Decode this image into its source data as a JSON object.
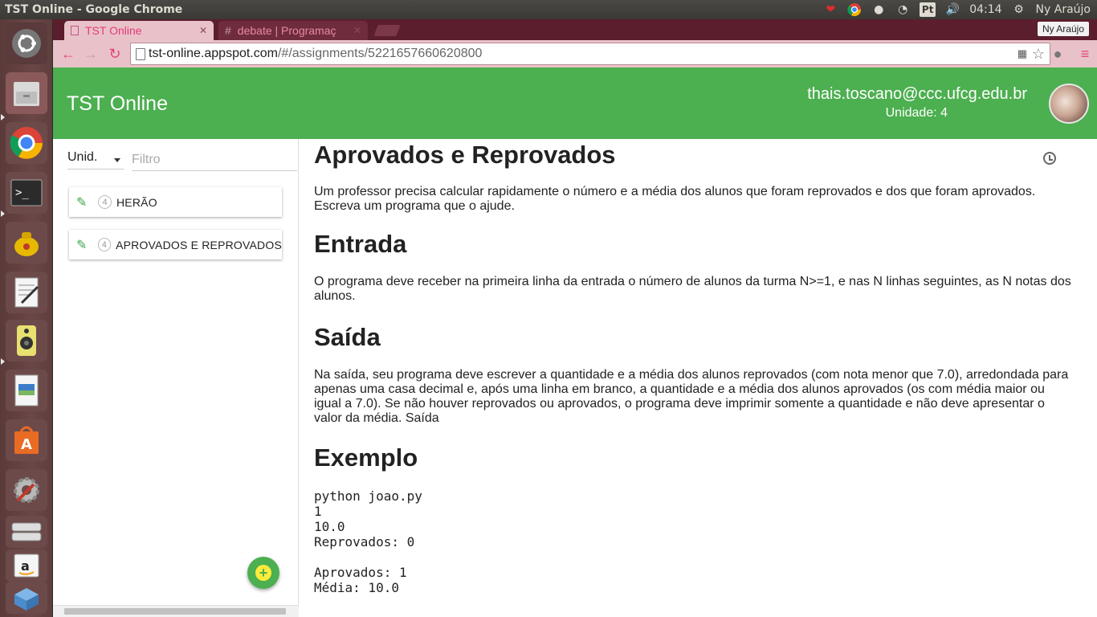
{
  "window": {
    "title": "TST Online - Google Chrome"
  },
  "tray": {
    "language": "Pt",
    "volume_icon": "speaker-icon",
    "time": "04:14",
    "user": "Ny Araújo"
  },
  "launcher": {
    "items": [
      "ubuntu-dash",
      "files",
      "chrome",
      "terminal",
      "teapot-app",
      "text-editor",
      "speaker-app",
      "impress",
      "software-center",
      "system-settings",
      "disks",
      "amazon",
      "archive-manager"
    ]
  },
  "browser": {
    "tabs": [
      {
        "label": "TST Online",
        "active": true
      },
      {
        "label": "debate | Programaç",
        "active": false
      }
    ],
    "profile": "Ny Araújo",
    "url_host": "tst-online.appspot.com",
    "url_path": "/#/assignments/5221657660620800"
  },
  "app": {
    "title": "TST Online",
    "user_email": "thais.toscano@ccc.ufcg.edu.br",
    "user_unit": "Unidade: 4",
    "accent": "#4caf50"
  },
  "sidebar": {
    "unit_select": "Unid.",
    "filter_placeholder": "Filtro",
    "assignments": [
      {
        "unit": "4",
        "title": "HERÃO"
      },
      {
        "unit": "4",
        "title": "APROVADOS E REPROVADOS"
      }
    ]
  },
  "content": {
    "title": "Aprovados e Reprovados",
    "intro": "Um professor precisa calcular rapidamente o número e a média dos alunos que foram reprovados e dos que foram aprovados. Escreva um programa que o ajude.",
    "input_heading": "Entrada",
    "input_text": "O programa deve receber na primeira linha da entrada o número de alunos da turma N>=1, e nas N linhas seguintes, as N notas dos alunos.",
    "output_heading": "Saída",
    "output_text": "Na saída, seu programa deve escrever a quantidade e a média dos alunos reprovados (com nota menor que 7.0), arredondada para apenas uma casa decimal e, após uma linha em branco, a quantidade e a média dos alunos aprovados (os com média maior ou igual a 7.0). Se não houver reprovados ou aprovados, o programa deve imprimir somente a quantidade e não deve apresentar o valor da média. Saída",
    "example_heading": "Exemplo",
    "example_code": "python joao.py\n1\n10.0\nReprovados: 0\n\nAprovados: 1\nMédia: 10.0"
  }
}
